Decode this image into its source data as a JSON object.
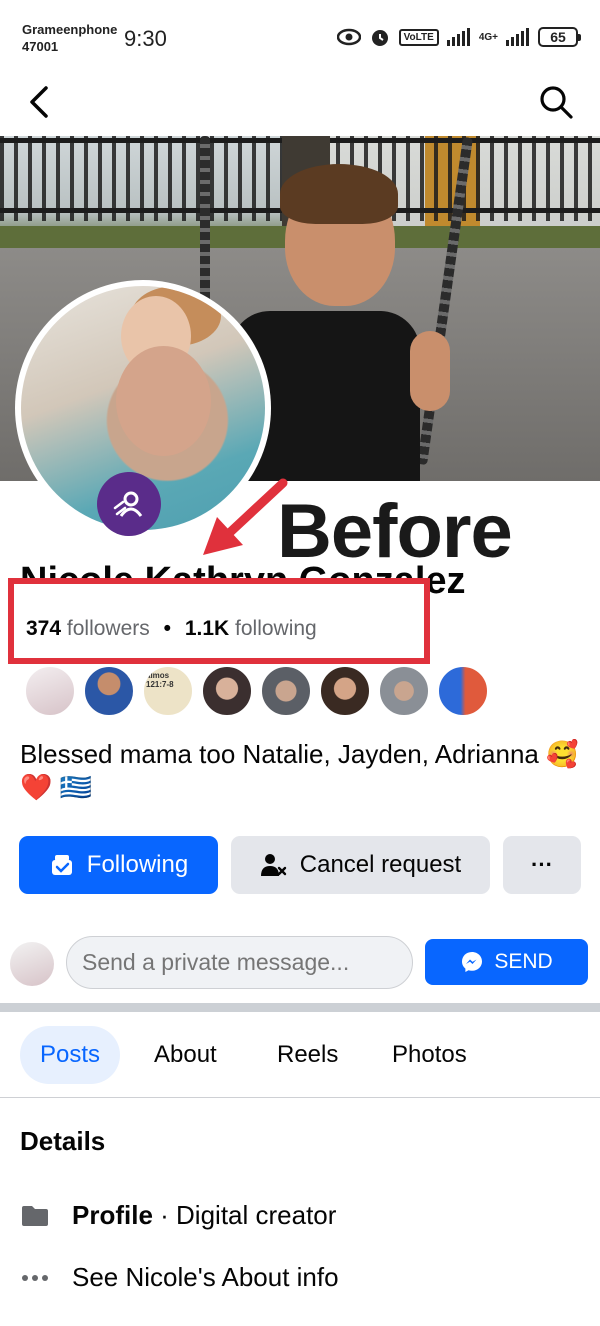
{
  "status_bar": {
    "carrier_line1": "Grameenphone",
    "carrier_line2": "47001",
    "time": "9:30",
    "volte": "VoLTE",
    "network": "4G+",
    "battery": "65"
  },
  "profile": {
    "name": "Nicole Kathryn Gonzalez",
    "followers_count": "374",
    "followers_label": "followers",
    "separator": "•",
    "following_count": "1.1K",
    "following_label": "following",
    "bio": "Blessed mama too Natalie, Jayden, Adrianna 🥰❤️ 🇬🇷"
  },
  "annotation": {
    "label": "Before",
    "highlight_color": "#e0313c"
  },
  "friends": [
    {
      "color": "#d7c3c8"
    },
    {
      "color": "#2b57a6"
    },
    {
      "color": "#ede3c7",
      "text": "almos 121:7-8"
    },
    {
      "color": "#3b2f2f"
    },
    {
      "color": "#5b5f66"
    },
    {
      "color": "#b58a6a"
    },
    {
      "color": "#8a8f96"
    },
    {
      "color": "#e05a3c"
    }
  ],
  "actions": {
    "following_label": "Following",
    "cancel_label": "Cancel request",
    "more_label": "···"
  },
  "message": {
    "placeholder": "Send a private message...",
    "send_label": "SEND"
  },
  "tabs": [
    {
      "label": "Posts",
      "active": true
    },
    {
      "label": "About"
    },
    {
      "label": "Reels"
    },
    {
      "label": "Photos"
    }
  ],
  "details": {
    "title": "Details",
    "profile_strong": "Profile",
    "profile_rest": " · Digital creator",
    "about_link": "See Nicole's About info"
  },
  "colors": {
    "brand_blue": "#0866ff",
    "button_gray": "#e4e6eb"
  }
}
